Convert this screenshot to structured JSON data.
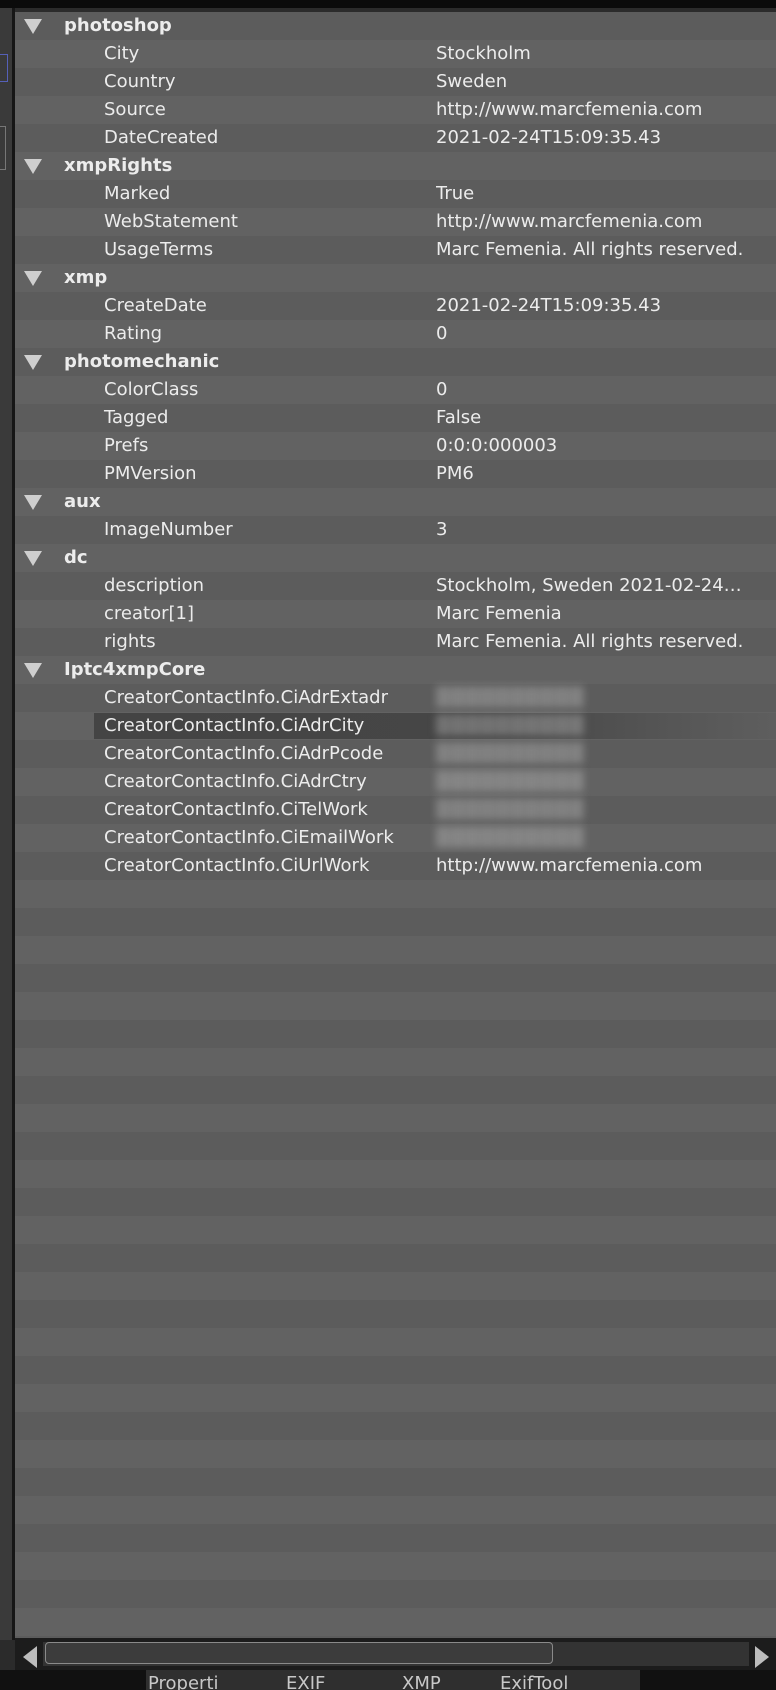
{
  "groups": [
    {
      "name": "photoshop",
      "rows": [
        {
          "key": "City",
          "value": "Stockholm"
        },
        {
          "key": "Country",
          "value": "Sweden"
        },
        {
          "key": "Source",
          "value": "http://www.marcfemenia.com"
        },
        {
          "key": "DateCreated",
          "value": "2021-02-24T15:09:35.43"
        }
      ]
    },
    {
      "name": "xmpRights",
      "rows": [
        {
          "key": "Marked",
          "value": "True"
        },
        {
          "key": "WebStatement",
          "value": "http://www.marcfemenia.com"
        },
        {
          "key": "UsageTerms",
          "value": "Marc Femenia. All rights reserved."
        }
      ]
    },
    {
      "name": "xmp",
      "rows": [
        {
          "key": "CreateDate",
          "value": "2021-02-24T15:09:35.43"
        },
        {
          "key": "Rating",
          "value": "0"
        }
      ]
    },
    {
      "name": "photomechanic",
      "rows": [
        {
          "key": "ColorClass",
          "value": "0"
        },
        {
          "key": "Tagged",
          "value": "False"
        },
        {
          "key": "Prefs",
          "value": "0:0:0:000003"
        },
        {
          "key": "PMVersion",
          "value": "PM6"
        }
      ]
    },
    {
      "name": "aux",
      "rows": [
        {
          "key": "ImageNumber",
          "value": "3"
        }
      ]
    },
    {
      "name": "dc",
      "rows": [
        {
          "key": "description",
          "value": "Stockholm, Sweden 2021-02-24…"
        },
        {
          "key": "creator[1]",
          "value": "Marc Femenia"
        },
        {
          "key": "rights",
          "value": "Marc Femenia. All rights reserved."
        }
      ]
    },
    {
      "name": "Iptc4xmpCore",
      "rows": [
        {
          "key": "CreatorContactInfo.CiAdrExtadr",
          "value": "",
          "blurred": true
        },
        {
          "key": "CreatorContactInfo.CiAdrCity",
          "value": "",
          "blurred": true,
          "selected": true
        },
        {
          "key": "CreatorContactInfo.CiAdrPcode",
          "value": "",
          "blurred": true
        },
        {
          "key": "CreatorContactInfo.CiAdrCtry",
          "value": "",
          "blurred": true
        },
        {
          "key": "CreatorContactInfo.CiTelWork",
          "value": "",
          "blurred": true
        },
        {
          "key": "CreatorContactInfo.CiEmailWork",
          "value": "",
          "blurred": true
        },
        {
          "key": "CreatorContactInfo.CiUrlWork",
          "value": "http://www.marcfemenia.com"
        }
      ]
    }
  ],
  "tabs": [
    "Properti",
    "EXIF",
    "XMP",
    "ExifTool"
  ],
  "colors": {
    "row_dark": "#5c5c5c",
    "row_light": "#626262",
    "text": "#ececec",
    "selection": "#444444"
  }
}
